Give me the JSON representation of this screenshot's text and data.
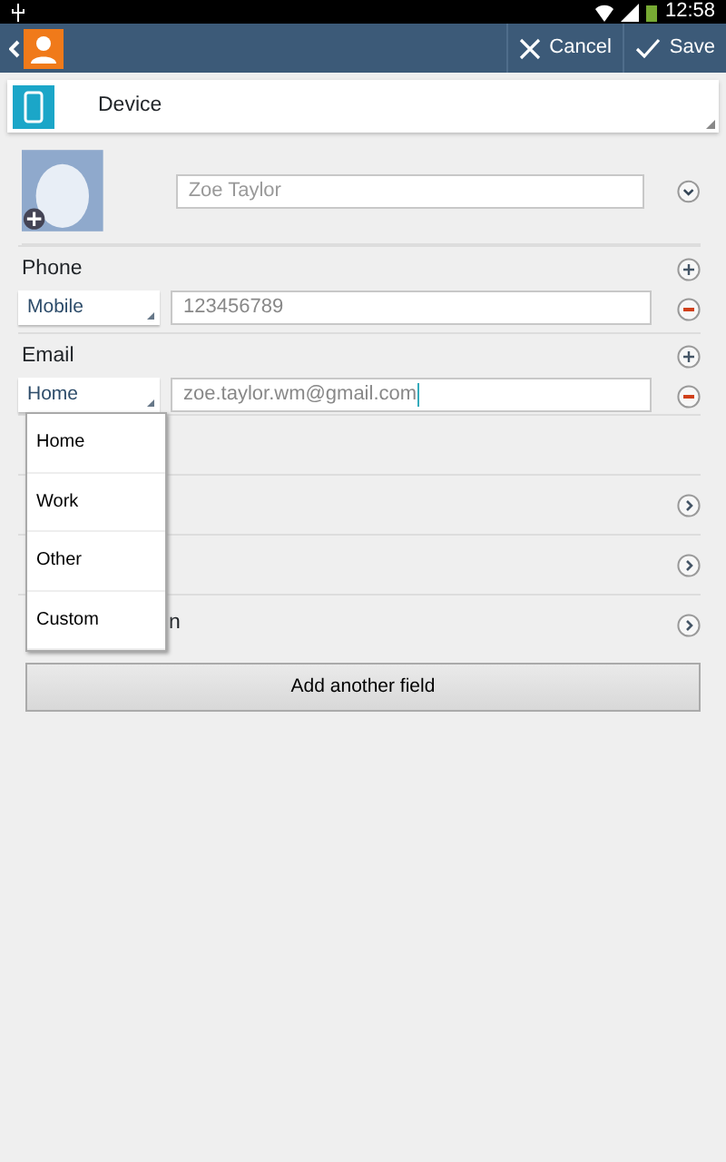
{
  "status_bar": {
    "time": "12:58"
  },
  "action_bar": {
    "cancel": "Cancel",
    "save": "Save"
  },
  "account": {
    "label": "Device"
  },
  "name": {
    "placeholder": "Zoe Taylor"
  },
  "sections": [
    {
      "title": "Phone",
      "type_label": "Mobile",
      "value": "123456789",
      "kind": "phone"
    },
    {
      "title": "Email",
      "type_label": "Home",
      "value": "zoe.taylor.wm@gmail.com",
      "kind": "email"
    }
  ],
  "hidden_rows": [
    {
      "title": ""
    },
    {
      "title": ""
    },
    {
      "title": ""
    },
    {
      "title": "n"
    }
  ],
  "dropdown": {
    "options": [
      "Home",
      "Work",
      "Other",
      "Custom"
    ]
  },
  "add_button": "Add another field"
}
